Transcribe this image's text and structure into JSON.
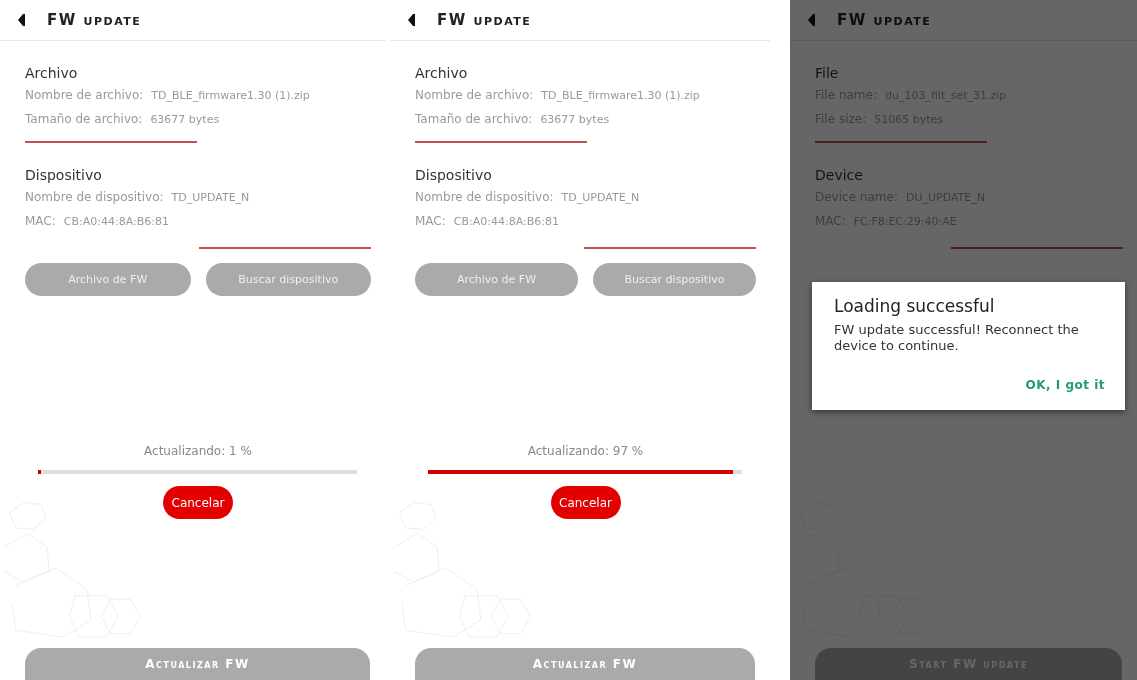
{
  "screens": [
    {
      "title": "FW update",
      "dimmed": false,
      "file_section": {
        "heading": "Archivo",
        "rows": [
          {
            "label": "Nombre de archivo:",
            "value": "TD_BLE_firmware1.30 (1).zip"
          },
          {
            "label": "Tamaño de archivo:",
            "value": "63677 bytes"
          }
        ]
      },
      "device_section": {
        "heading": "Dispositivo",
        "rows": [
          {
            "label": "Nombre de dispositivo:",
            "value": "TD_UPDATE_N"
          },
          {
            "label": "MAC:",
            "value": "CB:A0:44:8A:B6:81"
          }
        ]
      },
      "buttons": [
        "Archivo de FW",
        "Buscar dispositivo"
      ],
      "progress": {
        "label": "Actualizando: 1 %",
        "level": 0.01
      },
      "cancel_button": "Cancelar",
      "main_button": "Actualizar FW"
    },
    {
      "title": "FW update",
      "dimmed": false,
      "file_section": {
        "heading": "Archivo",
        "rows": [
          {
            "label": "Nombre de archivo:",
            "value": "TD_BLE_firmware1.30 (1).zip"
          },
          {
            "label": "Tamaño de archivo:",
            "value": "63677 bytes"
          }
        ]
      },
      "device_section": {
        "heading": "Dispositivo",
        "rows": [
          {
            "label": "Nombre de dispositivo:",
            "value": "TD_UPDATE_N"
          },
          {
            "label": "MAC:",
            "value": "CB:A0:44:8A:B6:81"
          }
        ]
      },
      "buttons": [
        "Archivo de FW",
        "Buscar dispositivo"
      ],
      "progress": {
        "label": "Actualizando: 97 %",
        "level": 0.97
      },
      "cancel_button": "Cancelar",
      "main_button": "Actualizar FW"
    },
    {
      "title": "FW update",
      "dimmed": true,
      "file_section": {
        "heading": "File",
        "rows": [
          {
            "label": "File name:",
            "value": "du_103_filt_set_31.zip"
          },
          {
            "label": "File size:",
            "value": "51065 bytes"
          }
        ]
      },
      "device_section": {
        "heading": "Device",
        "rows": [
          {
            "label": "Device name:",
            "value": "DU_UPDATE_N"
          },
          {
            "label": "MAC:",
            "value": "FC:F8:EC:29:40:AE"
          }
        ]
      },
      "main_button": "Start FW update",
      "dialog": {
        "title": "Loading successful",
        "message": "FW update successful! Reconnect the device to continue.",
        "action": "OK, I got it"
      }
    }
  ]
}
